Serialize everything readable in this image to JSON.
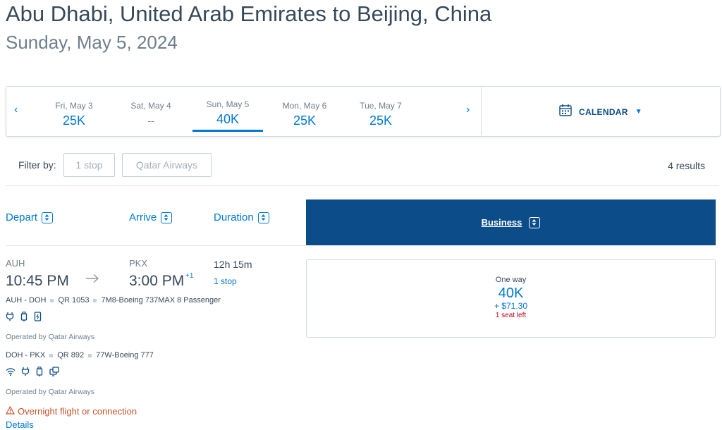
{
  "header": {
    "title": "Abu Dhabi, United Arab Emirates to Beijing, China",
    "date": "Sunday, May 5, 2024"
  },
  "date_bar": {
    "prev_icon": "chevron-left-icon",
    "next_icon": "chevron-right-icon",
    "dates": [
      {
        "day": "Fri, May 3",
        "price": "25K"
      },
      {
        "day": "Sat, May 4",
        "price": "--"
      },
      {
        "day": "Sun, May 5",
        "price": "40K",
        "selected": true
      },
      {
        "day": "Mon, May 6",
        "price": "25K"
      },
      {
        "day": "Tue, May 7",
        "price": "25K"
      }
    ],
    "calendar_label": "CALENDAR",
    "calendar_icon": "calendar-icon"
  },
  "filters": {
    "label": "Filter by:",
    "buttons": [
      "1 stop",
      "Qatar Airways"
    ],
    "results": "4 results"
  },
  "columns": {
    "depart": "Depart",
    "arrive": "Arrive",
    "duration": "Duration",
    "business": "Business"
  },
  "flight": {
    "origin": "AUH",
    "depart_time": "10:45 PM",
    "destination": "PKX",
    "arrive_time": "3:00 PM",
    "day_offset": "+1",
    "duration": "12h 15m",
    "stops": "1 stop",
    "segments": [
      {
        "route": "AUH - DOH",
        "flight_no": "QR 1053",
        "aircraft": "7M8-Boeing 737MAX 8 Passenger",
        "amenities": [
          "power-outlet-icon",
          "usb-icon",
          "phone-charging-icon"
        ],
        "operated_by": "Operated by Qatar Airways"
      },
      {
        "route": "DOH - PKX",
        "flight_no": "QR 892",
        "aircraft": "77W-Boeing 777",
        "amenities": [
          "wifi-icon",
          "power-outlet-icon",
          "usb-icon",
          "entertainment-icon"
        ],
        "operated_by": "Operated by Qatar Airways"
      }
    ],
    "warning": "Overnight flight or connection",
    "details_link": "Details"
  },
  "fare": {
    "type": "One way",
    "points": "40K",
    "taxes": "+ $71.30",
    "seats": "1 seat left"
  },
  "colors": {
    "brand_blue": "#0078d2",
    "header_navy": "#0c4c88",
    "text": "#36495a",
    "warning": "#c7542a",
    "alert_red": "#c30019"
  }
}
